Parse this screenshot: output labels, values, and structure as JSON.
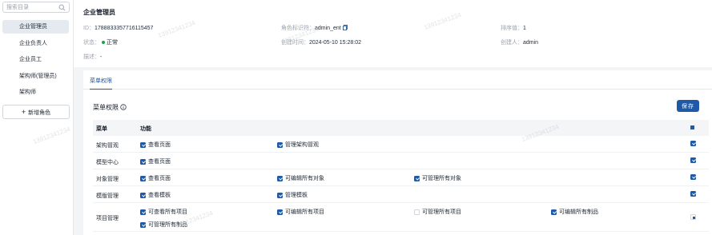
{
  "sidebar": {
    "search_placeholder": "搜索目录",
    "items": [
      {
        "label": "企业管理员",
        "active": true
      },
      {
        "label": "企业负责人",
        "active": false
      },
      {
        "label": "企业员工",
        "active": false
      },
      {
        "label": "架构师(管理员)",
        "active": false
      },
      {
        "label": "架构师",
        "active": false
      }
    ],
    "add_role_label": "新增角色"
  },
  "header": {
    "title": "企业管理员",
    "id_label": "ID：",
    "id_value": "1788833357716115457",
    "role_id_label": "角色标识符：",
    "role_id_value": "admin_ent",
    "sort_label": "排序值：",
    "sort_value": "1",
    "status_label": "状态：",
    "status_value": "正常",
    "created_time_label": "创建时间：",
    "created_time_value": "2024-05-10 15:28:02",
    "creator_label": "创建人：",
    "creator_value": "admin",
    "desc_label": "描述：",
    "desc_value": "-"
  },
  "tabs": [
    {
      "label": "菜单权限",
      "active": true
    }
  ],
  "permissions": {
    "title": "菜单权限",
    "save_label": "保存",
    "columns": {
      "menu": "菜单",
      "function": "功能"
    },
    "rows": [
      {
        "name": "架构冒观",
        "perms": [
          {
            "label": "查看页面",
            "checked": true
          },
          {
            "label": "管理架构冒观",
            "checked": true
          }
        ]
      },
      {
        "name": "模型中心",
        "perms": [
          {
            "label": "查看页面",
            "checked": true
          }
        ]
      },
      {
        "name": "对象管理",
        "perms": [
          {
            "label": "查看页面",
            "checked": true
          },
          {
            "label": "可编辑所有对象",
            "checked": true
          },
          {
            "label": "可管理所有对象",
            "checked": true
          }
        ]
      },
      {
        "name": "模版管理",
        "perms": [
          {
            "label": "查看模板",
            "checked": true
          },
          {
            "label": "管理模板",
            "checked": true
          }
        ]
      },
      {
        "name": "项目管理",
        "perms": [
          {
            "label": "可查看所有项目",
            "checked": true
          },
          {
            "label": "可编辑所有项目",
            "checked": true
          },
          {
            "label": "可管理所有项目",
            "checked": false
          },
          {
            "label": "可编辑所有制品",
            "checked": true
          },
          {
            "label": "可管理所有制品",
            "checked": true
          }
        ]
      }
    ]
  },
  "watermark": "13912341234",
  "colors": {
    "primary": "#1e5aa8",
    "status_ok": "#16a34a"
  }
}
